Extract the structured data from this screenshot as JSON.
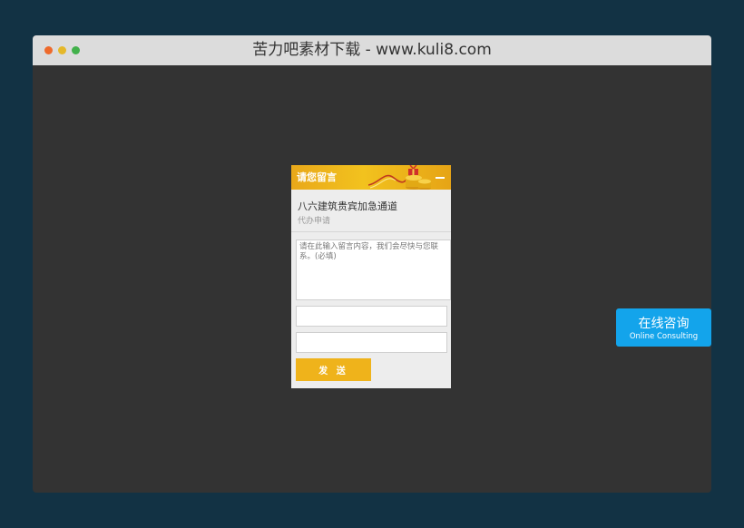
{
  "window": {
    "title": "苦力吧素材下载 - www.kuli8.com"
  },
  "message_box": {
    "header_title": "请您留言",
    "info_title": "八六建筑贵宾加急通道",
    "info_subtitle": "代办申请",
    "textarea_placeholder": "请在此输入留言内容，我们会尽快与您联系。(必填)",
    "send_label": "发 送"
  },
  "consult": {
    "label_cn": "在线咨询",
    "label_en": "Online Consulting"
  },
  "colors": {
    "page_bg": "#123244",
    "window_bg": "#333333",
    "accent": "#efb31b",
    "consult_blue": "#13a4eb"
  }
}
